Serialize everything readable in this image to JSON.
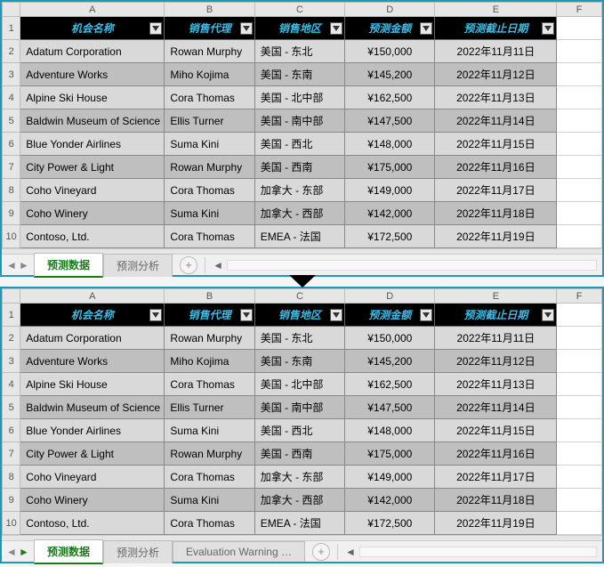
{
  "columns": [
    "A",
    "B",
    "C",
    "D",
    "E",
    "F"
  ],
  "rows": [
    1,
    2,
    3,
    4,
    5,
    6,
    7,
    8,
    9,
    10
  ],
  "headers": {
    "A": "机会名称",
    "B": "销售代理",
    "C": "销售地区",
    "D": "预测金额",
    "E": "预测截止日期"
  },
  "data": [
    {
      "A": "Adatum Corporation",
      "B": "Rowan Murphy",
      "C": "美国 - 东北",
      "D": "¥150,000",
      "E": "2022年11月11日"
    },
    {
      "A": "Adventure Works",
      "B": "Miho Kojima",
      "C": "美国 - 东南",
      "D": "¥145,200",
      "E": "2022年11月12日"
    },
    {
      "A": "Alpine Ski House",
      "B": "Cora Thomas",
      "C": "美国 - 北中部",
      "D": "¥162,500",
      "E": "2022年11月13日"
    },
    {
      "A": "Baldwin Museum of Science",
      "B": "Ellis Turner",
      "C": "美国 - 南中部",
      "D": "¥147,500",
      "E": "2022年11月14日"
    },
    {
      "A": "Blue Yonder Airlines",
      "B": "Suma Kini",
      "C": "美国 - 西北",
      "D": "¥148,000",
      "E": "2022年11月15日"
    },
    {
      "A": "City Power & Light",
      "B": "Rowan Murphy",
      "C": "美国 - 西南",
      "D": "¥175,000",
      "E": "2022年11月16日"
    },
    {
      "A": "Coho Vineyard",
      "B": "Cora Thomas",
      "C": "加拿大 - 东部",
      "D": "¥149,000",
      "E": "2022年11月17日"
    },
    {
      "A": "Coho Winery",
      "B": "Suma Kini",
      "C": "加拿大 - 西部",
      "D": "¥142,000",
      "E": "2022年11月18日"
    },
    {
      "A": "Contoso, Ltd.",
      "B": "Cora Thomas",
      "C": "EMEA - 法国",
      "D": "¥172,500",
      "E": "2022年11月19日"
    }
  ],
  "tabs_top": {
    "active": "预测数据",
    "other": "预测分析"
  },
  "tabs_bottom": {
    "active": "预测数据",
    "other1": "预测分析",
    "other2": "Evaluation Warning …"
  },
  "chart_data": {
    "type": "table",
    "title": "预测数据",
    "columns": [
      "机会名称",
      "销售代理",
      "销售地区",
      "预测金额",
      "预测截止日期"
    ],
    "rows": [
      [
        "Adatum Corporation",
        "Rowan Murphy",
        "美国 - 东北",
        150000,
        "2022-11-11"
      ],
      [
        "Adventure Works",
        "Miho Kojima",
        "美国 - 东南",
        145200,
        "2022-11-12"
      ],
      [
        "Alpine Ski House",
        "Cora Thomas",
        "美国 - 北中部",
        162500,
        "2022-11-13"
      ],
      [
        "Baldwin Museum of Science",
        "Ellis Turner",
        "美国 - 南中部",
        147500,
        "2022-11-14"
      ],
      [
        "Blue Yonder Airlines",
        "Suma Kini",
        "美国 - 西北",
        148000,
        "2022-11-15"
      ],
      [
        "City Power & Light",
        "Rowan Murphy",
        "美国 - 西南",
        175000,
        "2022-11-16"
      ],
      [
        "Coho Vineyard",
        "Cora Thomas",
        "加拿大 - 东部",
        149000,
        "2022-11-17"
      ],
      [
        "Coho Winery",
        "Suma Kini",
        "加拿大 - 西部",
        142000,
        "2022-11-18"
      ],
      [
        "Contoso, Ltd.",
        "Cora Thomas",
        "EMEA - 法国",
        172500,
        "2022-11-19"
      ]
    ]
  }
}
